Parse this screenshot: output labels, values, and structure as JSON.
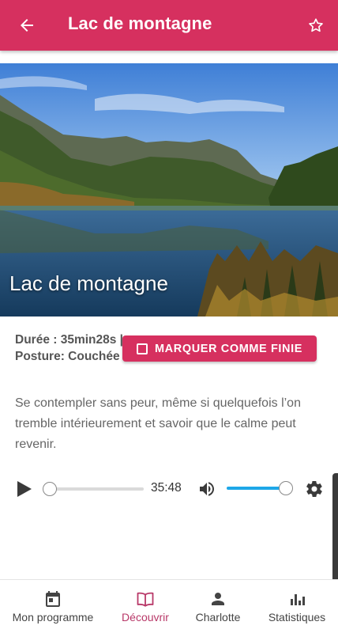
{
  "appbar": {
    "title": "Lac de montagne",
    "back_icon": "arrow-left-icon",
    "favorite_icon": "star-outline-icon"
  },
  "hero": {
    "caption": "Lac de montagne"
  },
  "details": {
    "meta": "Durée : 35min28s | Posture: Couchée",
    "mark_button_label": "MARQUER COMME FINIE",
    "description": "Se contempler sans peur, même si quelquefois l’on tremble intérieurement et savoir que le calme peut revenir."
  },
  "player": {
    "time": "35:48",
    "progress": 0,
    "volume": 1.0
  },
  "bottom_nav": {
    "items": [
      {
        "label": "Mon programme",
        "icon": "calendar-icon",
        "active": false
      },
      {
        "label": "Découvrir",
        "icon": "book-open-icon",
        "active": true
      },
      {
        "label": "Charlotte",
        "icon": "person-icon",
        "active": false
      },
      {
        "label": "Statistiques",
        "icon": "bar-chart-icon",
        "active": false
      }
    ]
  },
  "colors": {
    "primary": "#d6305f",
    "active_nav": "#b83868",
    "volume": "#1ea7e8"
  }
}
